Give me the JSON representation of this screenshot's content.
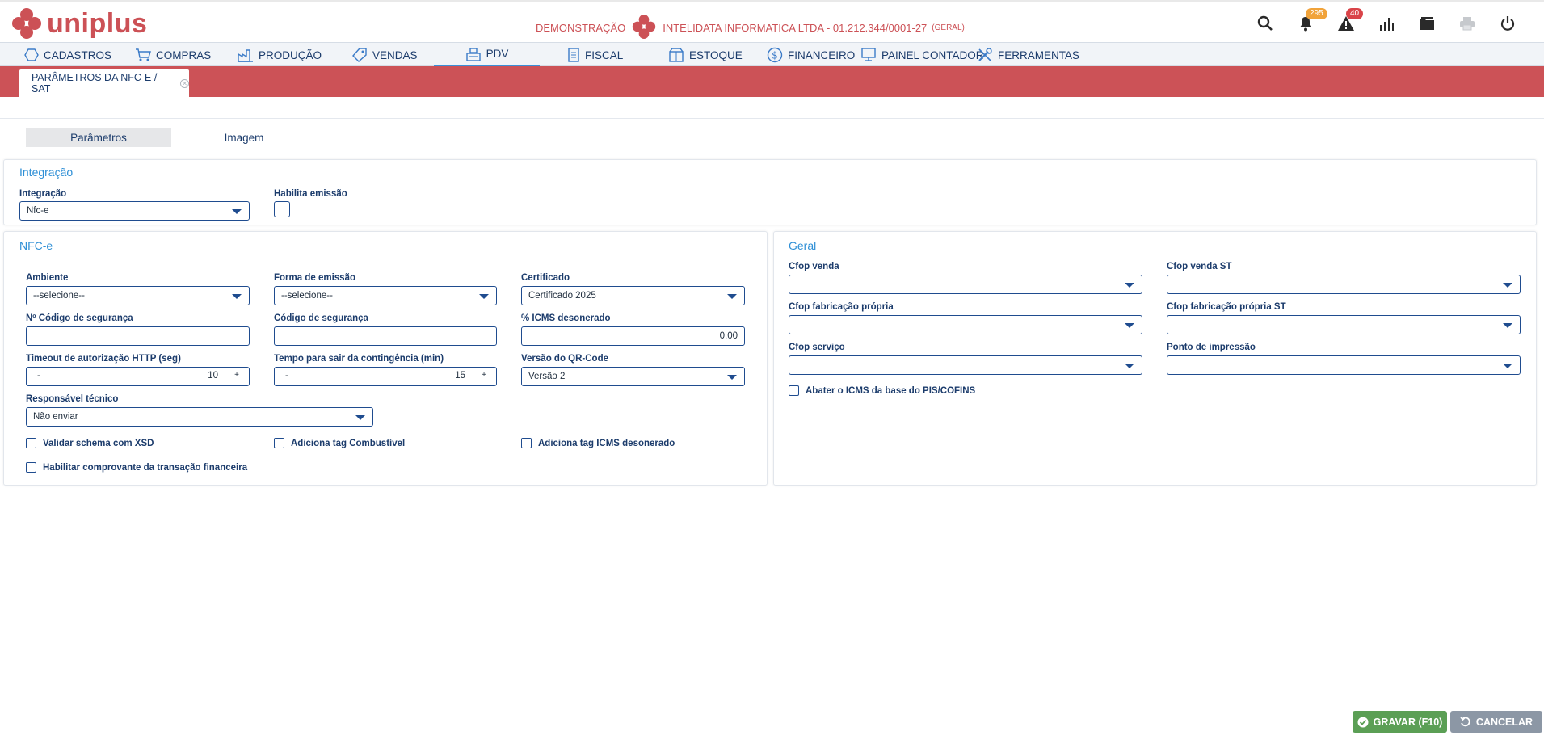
{
  "header": {
    "brand": "uniplus",
    "mode": "DEMONSTRAÇÃO",
    "company": "INTELIDATA INFORMATICA LTDA - 01.212.344/0001-27",
    "company_tag": "(GERAL)",
    "notifications_count": "295",
    "alerts_count": "40"
  },
  "menu": {
    "items": [
      {
        "label": "CADASTROS",
        "icon": "hexagon-icon"
      },
      {
        "label": "COMPRAS",
        "icon": "cart-icon"
      },
      {
        "label": "PRODUÇÃO",
        "icon": "factory-icon"
      },
      {
        "label": "VENDAS",
        "icon": "tag-icon"
      },
      {
        "label": "PDV",
        "icon": "register-icon"
      },
      {
        "label": "FISCAL",
        "icon": "document-icon"
      },
      {
        "label": "ESTOQUE",
        "icon": "box-icon"
      },
      {
        "label": "FINANCEIRO",
        "icon": "dollar-icon"
      },
      {
        "label": "PAINEL CONTADOR",
        "icon": "monitor-icon"
      },
      {
        "label": "FERRAMENTAS",
        "icon": "tools-icon"
      }
    ],
    "active": "PDV"
  },
  "page_tab": {
    "label": "PARÂMETROS DA NFC-E / SAT"
  },
  "subtabs": {
    "params": "Parâmetros",
    "image": "Imagem"
  },
  "integracao": {
    "title": "Integração",
    "integracao_label": "Integração",
    "integracao_value": "Nfc-e",
    "habilita_label": "Habilita emissão"
  },
  "nfce": {
    "title": "NFC-e",
    "ambiente_label": "Ambiente",
    "ambiente_value": "--selecione--",
    "forma_label": "Forma de emissão",
    "forma_value": "--selecione--",
    "certificado_label": "Certificado",
    "certificado_value": "Certificado 2025",
    "num_codigo_label": "Nº Código de segurança",
    "codigo_label": "Código de segurança",
    "icms_label": "% ICMS desonerado",
    "icms_value": "0,00",
    "timeout_label": "Timeout de autorização HTTP (seg)",
    "timeout_value": "10",
    "tempo_label": "Tempo para sair da contingência (min)",
    "tempo_value": "15",
    "versao_label": "Versão do QR-Code",
    "versao_value": "Versão 2",
    "resp_label": "Responsável técnico",
    "resp_value": "Não enviar",
    "chk_xsd": "Validar schema com XSD",
    "chk_combustivel": "Adiciona tag Combustível",
    "chk_icms": "Adiciona tag ICMS desonerado",
    "chk_comprovante": "Habilitar comprovante da transação financeira",
    "minus": "-",
    "plus": "+"
  },
  "geral": {
    "title": "Geral",
    "cfop_venda": "Cfop venda",
    "cfop_venda_st": "Cfop venda ST",
    "cfop_fab": "Cfop fabricação própria",
    "cfop_fab_st": "Cfop fabricação própria ST",
    "cfop_servico": "Cfop serviço",
    "ponto_impressao": "Ponto de impressão",
    "chk_abater": "Abater o ICMS da base do PIS/COFINS"
  },
  "footer": {
    "save": "GRAVAR (F10)",
    "cancel": "CANCELAR"
  },
  "colors": {
    "brand_red": "#cc5257",
    "accent_blue": "#2e8fd6",
    "save_green": "#5b9f55",
    "cancel_gray": "#8c97a5"
  }
}
